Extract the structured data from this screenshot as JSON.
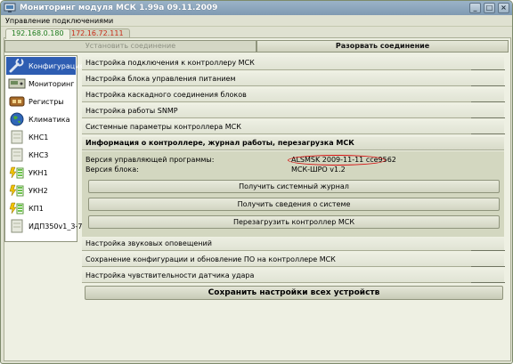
{
  "window": {
    "title": "Мониторинг модуля МСК 1.99а 09.11.2009",
    "controls": [
      "minimize-icon",
      "maximize-icon",
      "close-icon"
    ]
  },
  "menu": {
    "label": "Управление подключениями"
  },
  "ip_tabs": [
    {
      "label": "192.168.0.180",
      "active": true,
      "color": "#1b7a1b"
    },
    {
      "label": "172.16.72.111",
      "active": false,
      "color": "#c72a16"
    }
  ],
  "connection": {
    "connect_label": "Установить соединение",
    "disconnect_label": "Разорвать соединение"
  },
  "sidebar": {
    "items": [
      {
        "label": "Конфигурация",
        "icon": "wrench-icon",
        "active": true
      },
      {
        "label": "Мониторинг",
        "icon": "monitor-icon",
        "active": false
      },
      {
        "label": "Регистры",
        "icon": "register-icon",
        "active": false
      },
      {
        "label": "Климатика",
        "icon": "globe-icon",
        "active": false
      },
      {
        "label": "КНС1",
        "icon": "device-icon",
        "active": false
      },
      {
        "label": "КНС3",
        "icon": "device-icon",
        "active": false
      },
      {
        "label": "УКН1",
        "icon": "battery-icon",
        "active": false
      },
      {
        "label": "УКН2",
        "icon": "battery-icon",
        "active": false
      },
      {
        "label": "КП1",
        "icon": "battery-icon",
        "active": false
      },
      {
        "label": "ИДП350v1_3-7",
        "icon": "device-icon",
        "active": false
      }
    ]
  },
  "sections_top": [
    "Настройка подключения к контроллеру МСК",
    "Настройка блока управления питанием",
    "Настройка каскадного соединения блоков",
    "Настройка работы SNMP",
    "Системные параметры контроллера МСК"
  ],
  "open_section": {
    "title": "Информация о контроллере, журнал работы, перезагрузка МСК",
    "software_label": "Версия управляющей программы:",
    "software_value": "ALSMSK 2009-11-11 cce9562",
    "block_label": "Версия блока:",
    "block_value": "МСК-ШРО v1.2",
    "buttons": [
      "Получить системный журнал",
      "Получить сведения о системе",
      "Перезагрузить контроллер МСК"
    ]
  },
  "sections_bottom": [
    "Настройка звуковых оповещений",
    "Сохранение конфигурации и обновление ПО на контроллере МСК",
    "Настройка чувствительности датчика удара"
  ],
  "save_all_label": "Сохранить настройки всех устройств",
  "colors": {
    "selection": "#2e5db2",
    "highlight_ellipse": "#d41313",
    "titlebar": "#8aa4bb"
  }
}
